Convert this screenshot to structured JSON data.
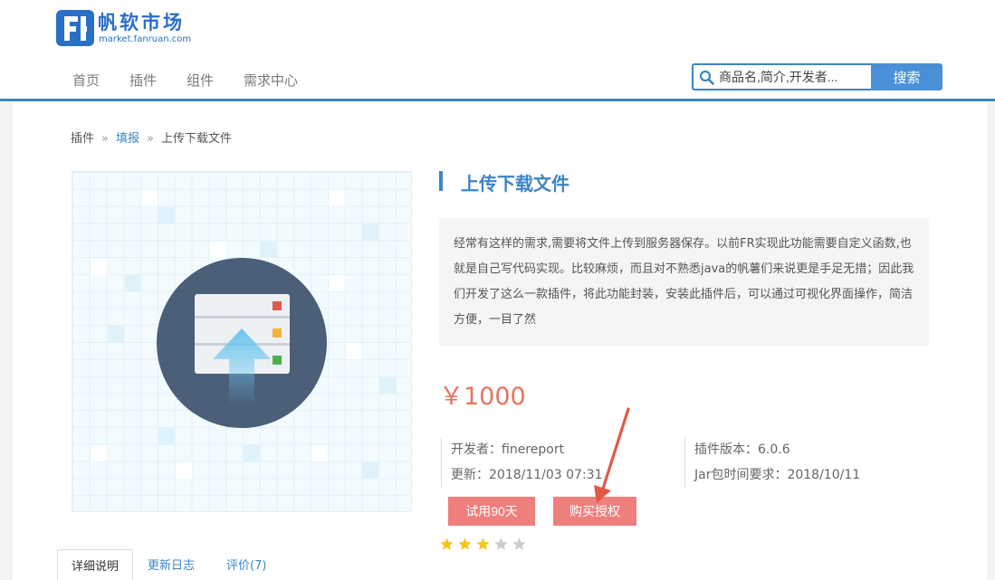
{
  "header": {
    "logo_title": "帆软市场",
    "logo_url_text": "market.fanruan.com"
  },
  "nav": {
    "items": [
      {
        "label": "首页"
      },
      {
        "label": "插件"
      },
      {
        "label": "组件"
      },
      {
        "label": "需求中心"
      }
    ]
  },
  "search": {
    "placeholder": "商品名,简介,开发者...",
    "button_label": "搜索"
  },
  "breadcrumb": {
    "items": [
      "插件",
      "填报",
      "上传下载文件"
    ],
    "separator": "»"
  },
  "plugin": {
    "title": "上传下载文件",
    "description": "经常有这样的需求,需要将文件上传到服务器保存。以前FR实现此功能需要自定义函数,也就是自己写代码实现。比较麻烦，而且对不熟悉java的帆薯们来说更是手足无措；因此我们开发了这么一款插件，将此功能封装，安装此插件后，可以通过可视化界面操作，简洁方便，一目了然",
    "price": "￥1000",
    "developer": "开发者：finereport",
    "updated": "更新：2018/11/03 07:31",
    "version": "插件版本：6.0.6",
    "jar_requirement": "Jar包时间要求：2018/10/11",
    "rating": 3,
    "rating_max": 5
  },
  "actions": {
    "trial_label": "试用90天",
    "buy_label": "购买授权"
  },
  "tabs": [
    {
      "label": "详细说明"
    },
    {
      "label": "更新日志"
    },
    {
      "label": "评价(7)"
    }
  ],
  "colors": {
    "brand": "#3d85c6",
    "price": "#e8735f",
    "action_button": "#ef7f7d",
    "annotation_arrow": "#e15a45",
    "star_on": "#f5c518",
    "star_off": "#cccccc"
  }
}
